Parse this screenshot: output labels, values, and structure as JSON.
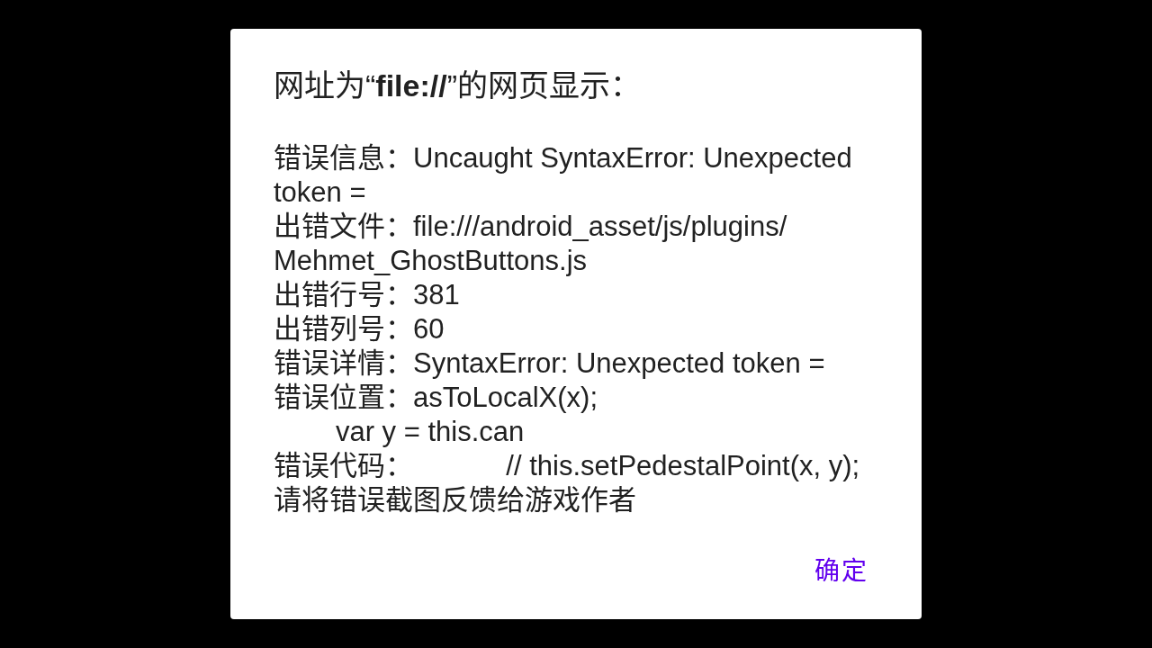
{
  "dialog": {
    "title": "网址为“**file://**”的网页显示：",
    "message_lines": [
      "错误信息：Uncaught SyntaxError: Unexpected token =",
      "出错文件：file:///android_asset/js/plugins/Mehmet_GhostButtons.js",
      "出错行号：381",
      "出错列号：60",
      "错误详情：SyntaxError: Unexpected token =",
      "错误位置：asToLocalX(x);\n        var y = this.can",
      "错误代码：            // this.setPedestalPoint(x, y);",
      "请将错误截图反馈给游戏作者"
    ],
    "buttons": [
      {
        "label": "确定"
      }
    ]
  }
}
